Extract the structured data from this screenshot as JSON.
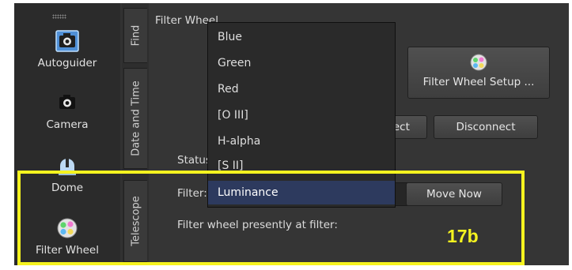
{
  "sidebar": {
    "items": [
      {
        "label": "Autoguider",
        "icon": "camera-icon"
      },
      {
        "label": "Camera",
        "icon": "camera-icon"
      },
      {
        "label": "Dome",
        "icon": "dome-icon"
      },
      {
        "label": "Filter Wheel",
        "icon": "filter-wheel-icon"
      }
    ]
  },
  "tabs": [
    {
      "label": "Find"
    },
    {
      "label": "Date and Time"
    },
    {
      "label": "Telescope"
    }
  ],
  "panel": {
    "title": "Filter Wheel",
    "setup_button": "Filter Wheel Setup ...",
    "connect_button": "Connect",
    "disconnect_button": "Disconnect",
    "status_label": "Status:",
    "filter_label": "Filter:",
    "move_button": "Move Now",
    "present_label": "Filter wheel presently at filter:"
  },
  "dropdown": {
    "options": [
      "Blue",
      "Green",
      "Red",
      "[O III]",
      "H-alpha",
      "[S II]",
      "Luminance"
    ],
    "selected": "Luminance"
  },
  "annotation": {
    "label": "17b",
    "color": "#f5f31f"
  },
  "colors": {
    "background": "#323232",
    "selection": "#2d3a5e"
  }
}
